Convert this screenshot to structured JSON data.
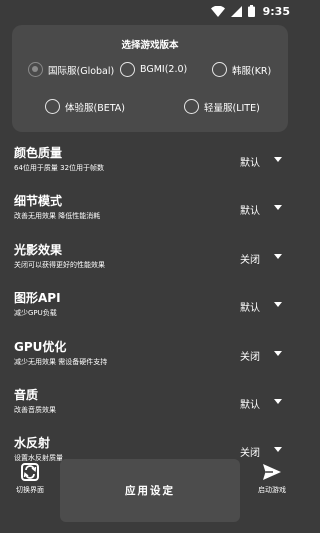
{
  "status_bar": {
    "time": "9:35",
    "icons": [
      "wifi-icon",
      "signal-icon",
      "battery-icon"
    ]
  },
  "version_card": {
    "title": "选择游戏版本",
    "options": [
      {
        "label": "国际服(Global)",
        "selected": true
      },
      {
        "label": "BGMI(2.0)",
        "selected": false
      },
      {
        "label": "韩服(KR)",
        "selected": false
      },
      {
        "label": "体验服(BETA)",
        "selected": false
      },
      {
        "label": "轻量服(LITE)",
        "selected": false
      }
    ]
  },
  "settings": [
    {
      "title": "颜色质量",
      "desc": "64位用于质量 32位用于帧数",
      "value": "默认"
    },
    {
      "title": "细节模式",
      "desc": "改善无用效果 降低性能消耗",
      "value": "默认"
    },
    {
      "title": "光影效果",
      "desc": "关闭可以获得更好的性能效果",
      "value": "关闭"
    },
    {
      "title": "图形API",
      "desc": "减少GPU负载",
      "value": "默认"
    },
    {
      "title": "GPU优化",
      "desc": "减少无用效果 需设备硬件支持",
      "value": "关闭"
    },
    {
      "title": "音质",
      "desc": "改善音质效果",
      "value": "默认"
    },
    {
      "title": "水反射",
      "desc": "设置水反射质量",
      "value": "关闭"
    }
  ],
  "bottom_bar": {
    "switch_label": "切换界面",
    "apply_label": "应用设定",
    "launch_label": "启动游戏"
  },
  "colors": {
    "background": "#3b3b3b",
    "card": "#4a4a4a",
    "button": "#4c4c4c",
    "text": "#ffffff"
  }
}
